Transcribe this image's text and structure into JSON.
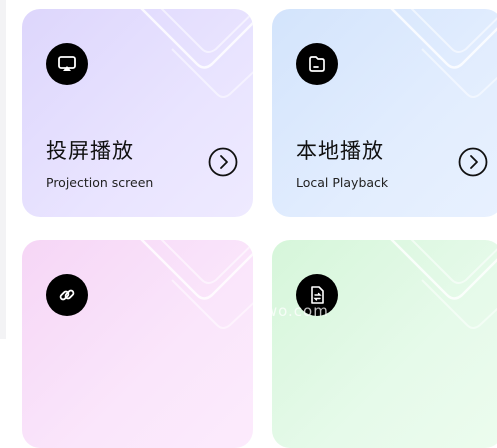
{
  "cards": [
    {
      "title": "投屏播放",
      "subtitle": "Projection screen",
      "icon": "screen-cast-icon",
      "gradient": [
        "#d9d3fb",
        "#ece7ff"
      ]
    },
    {
      "title": "本地播放",
      "subtitle": "Local Playback",
      "icon": "folder-icon",
      "gradient": [
        "#d2e4fc",
        "#e6f0fe"
      ]
    },
    {
      "title": "",
      "subtitle": "",
      "icon": "link-icon",
      "gradient": [
        "#f8d8f6",
        "#fbe8fb"
      ]
    },
    {
      "title": "",
      "subtitle": "",
      "icon": "file-transfer-icon",
      "gradient": [
        "#d8f7dc",
        "#ebfbed"
      ]
    }
  ],
  "watermark": "iTwo.com"
}
